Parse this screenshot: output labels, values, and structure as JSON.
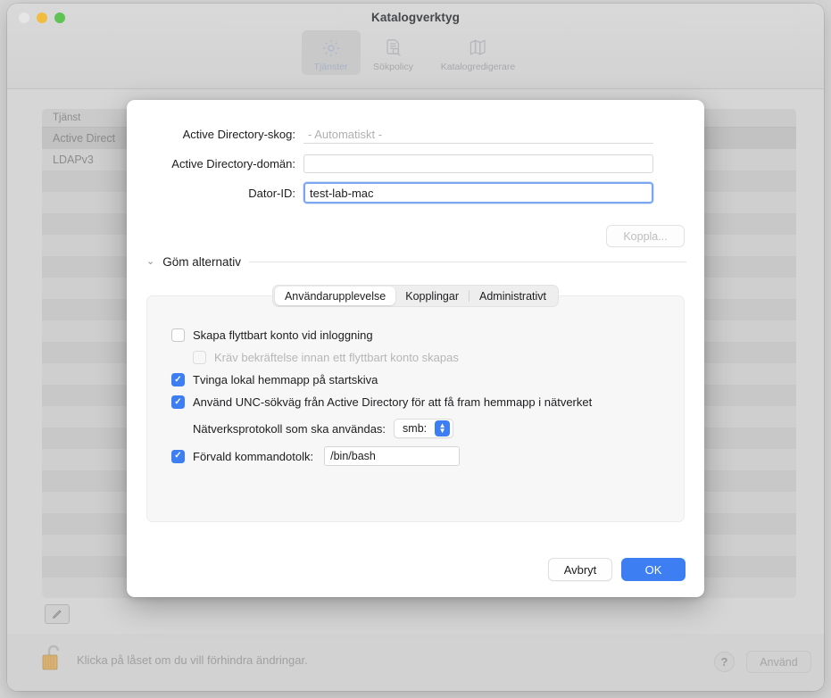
{
  "window": {
    "title": "Katalogverktyg",
    "traffic_lights": [
      "close-button",
      "minimize-button",
      "zoom-button"
    ]
  },
  "toolbar": {
    "items": [
      {
        "label": "Tjänster",
        "icon": "gear-icon",
        "selected": true
      },
      {
        "label": "Sökpolicy",
        "icon": "document-search-icon",
        "selected": false
      },
      {
        "label": "Katalogredigerare",
        "icon": "map-icon",
        "selected": false
      }
    ]
  },
  "services_table": {
    "column_header": "Tjänst",
    "rows": [
      {
        "name": "Active Direct",
        "selected": true
      },
      {
        "name": "LDAPv3",
        "selected": false
      }
    ]
  },
  "statusbar": {
    "lock_icon": "unlocked-padlock-icon",
    "message": "Klicka på låset om du vill förhindra ändringar.",
    "help_label": "?",
    "apply_label": "Använd"
  },
  "sheet": {
    "fields": [
      {
        "label": "Active Directory-skog:",
        "value": "- Automatiskt -",
        "style": "placeholder"
      },
      {
        "label": "Active Directory-domän:",
        "value": "",
        "style": "boxed"
      },
      {
        "label": "Dator-ID:",
        "value": "test-lab-mac",
        "style": "focused"
      }
    ],
    "bind_button_label": "Koppla...",
    "disclosure_label": "Göm alternativ",
    "tabs": [
      {
        "label": "Användarupplevelse",
        "selected": true
      },
      {
        "label": "Kopplingar",
        "selected": false
      },
      {
        "label": "Administrativt",
        "selected": false
      }
    ],
    "options": [
      {
        "label": "Skapa flyttbart konto vid inloggning",
        "checked": false,
        "enabled": true
      },
      {
        "label": "Kräv bekräftelse innan ett flyttbart konto skapas",
        "checked": false,
        "enabled": false
      },
      {
        "label": "Tvinga lokal hemmapp på startskiva",
        "checked": true,
        "enabled": true
      },
      {
        "label": "Använd UNC-sökväg från Active Directory för att få fram hemmapp i nätverket",
        "checked": true,
        "enabled": true
      }
    ],
    "protocol_row": {
      "label": "Nätverksprotokoll som ska användas:",
      "selected_value": "smb:"
    },
    "shell_row": {
      "label": "Förvald kommandotolk:",
      "checked": true,
      "value": "/bin/bash"
    },
    "cancel_label": "Avbryt",
    "ok_label": "OK"
  },
  "colors": {
    "accent": "#3d7ef2",
    "focus_ring": "#7aa7f0",
    "window_bg": "#d6d6d6",
    "sheet_bg": "#ffffff",
    "lock_gold": "#d9b274"
  }
}
